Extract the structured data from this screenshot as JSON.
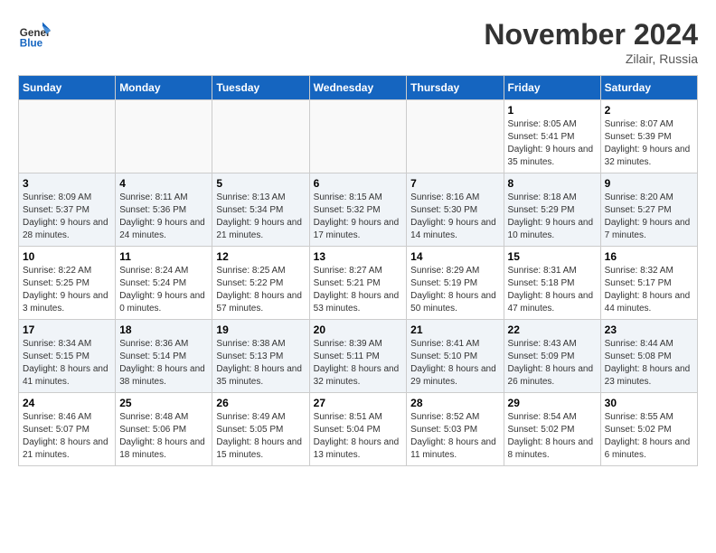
{
  "header": {
    "logo_line1": "General",
    "logo_line2": "Blue",
    "month": "November 2024",
    "location": "Zilair, Russia"
  },
  "weekdays": [
    "Sunday",
    "Monday",
    "Tuesday",
    "Wednesday",
    "Thursday",
    "Friday",
    "Saturday"
  ],
  "weeks": [
    [
      {
        "day": "",
        "info": ""
      },
      {
        "day": "",
        "info": ""
      },
      {
        "day": "",
        "info": ""
      },
      {
        "day": "",
        "info": ""
      },
      {
        "day": "",
        "info": ""
      },
      {
        "day": "1",
        "info": "Sunrise: 8:05 AM\nSunset: 5:41 PM\nDaylight: 9 hours and 35 minutes."
      },
      {
        "day": "2",
        "info": "Sunrise: 8:07 AM\nSunset: 5:39 PM\nDaylight: 9 hours and 32 minutes."
      }
    ],
    [
      {
        "day": "3",
        "info": "Sunrise: 8:09 AM\nSunset: 5:37 PM\nDaylight: 9 hours and 28 minutes."
      },
      {
        "day": "4",
        "info": "Sunrise: 8:11 AM\nSunset: 5:36 PM\nDaylight: 9 hours and 24 minutes."
      },
      {
        "day": "5",
        "info": "Sunrise: 8:13 AM\nSunset: 5:34 PM\nDaylight: 9 hours and 21 minutes."
      },
      {
        "day": "6",
        "info": "Sunrise: 8:15 AM\nSunset: 5:32 PM\nDaylight: 9 hours and 17 minutes."
      },
      {
        "day": "7",
        "info": "Sunrise: 8:16 AM\nSunset: 5:30 PM\nDaylight: 9 hours and 14 minutes."
      },
      {
        "day": "8",
        "info": "Sunrise: 8:18 AM\nSunset: 5:29 PM\nDaylight: 9 hours and 10 minutes."
      },
      {
        "day": "9",
        "info": "Sunrise: 8:20 AM\nSunset: 5:27 PM\nDaylight: 9 hours and 7 minutes."
      }
    ],
    [
      {
        "day": "10",
        "info": "Sunrise: 8:22 AM\nSunset: 5:25 PM\nDaylight: 9 hours and 3 minutes."
      },
      {
        "day": "11",
        "info": "Sunrise: 8:24 AM\nSunset: 5:24 PM\nDaylight: 9 hours and 0 minutes."
      },
      {
        "day": "12",
        "info": "Sunrise: 8:25 AM\nSunset: 5:22 PM\nDaylight: 8 hours and 57 minutes."
      },
      {
        "day": "13",
        "info": "Sunrise: 8:27 AM\nSunset: 5:21 PM\nDaylight: 8 hours and 53 minutes."
      },
      {
        "day": "14",
        "info": "Sunrise: 8:29 AM\nSunset: 5:19 PM\nDaylight: 8 hours and 50 minutes."
      },
      {
        "day": "15",
        "info": "Sunrise: 8:31 AM\nSunset: 5:18 PM\nDaylight: 8 hours and 47 minutes."
      },
      {
        "day": "16",
        "info": "Sunrise: 8:32 AM\nSunset: 5:17 PM\nDaylight: 8 hours and 44 minutes."
      }
    ],
    [
      {
        "day": "17",
        "info": "Sunrise: 8:34 AM\nSunset: 5:15 PM\nDaylight: 8 hours and 41 minutes."
      },
      {
        "day": "18",
        "info": "Sunrise: 8:36 AM\nSunset: 5:14 PM\nDaylight: 8 hours and 38 minutes."
      },
      {
        "day": "19",
        "info": "Sunrise: 8:38 AM\nSunset: 5:13 PM\nDaylight: 8 hours and 35 minutes."
      },
      {
        "day": "20",
        "info": "Sunrise: 8:39 AM\nSunset: 5:11 PM\nDaylight: 8 hours and 32 minutes."
      },
      {
        "day": "21",
        "info": "Sunrise: 8:41 AM\nSunset: 5:10 PM\nDaylight: 8 hours and 29 minutes."
      },
      {
        "day": "22",
        "info": "Sunrise: 8:43 AM\nSunset: 5:09 PM\nDaylight: 8 hours and 26 minutes."
      },
      {
        "day": "23",
        "info": "Sunrise: 8:44 AM\nSunset: 5:08 PM\nDaylight: 8 hours and 23 minutes."
      }
    ],
    [
      {
        "day": "24",
        "info": "Sunrise: 8:46 AM\nSunset: 5:07 PM\nDaylight: 8 hours and 21 minutes."
      },
      {
        "day": "25",
        "info": "Sunrise: 8:48 AM\nSunset: 5:06 PM\nDaylight: 8 hours and 18 minutes."
      },
      {
        "day": "26",
        "info": "Sunrise: 8:49 AM\nSunset: 5:05 PM\nDaylight: 8 hours and 15 minutes."
      },
      {
        "day": "27",
        "info": "Sunrise: 8:51 AM\nSunset: 5:04 PM\nDaylight: 8 hours and 13 minutes."
      },
      {
        "day": "28",
        "info": "Sunrise: 8:52 AM\nSunset: 5:03 PM\nDaylight: 8 hours and 11 minutes."
      },
      {
        "day": "29",
        "info": "Sunrise: 8:54 AM\nSunset: 5:02 PM\nDaylight: 8 hours and 8 minutes."
      },
      {
        "day": "30",
        "info": "Sunrise: 8:55 AM\nSunset: 5:02 PM\nDaylight: 8 hours and 6 minutes."
      }
    ]
  ]
}
